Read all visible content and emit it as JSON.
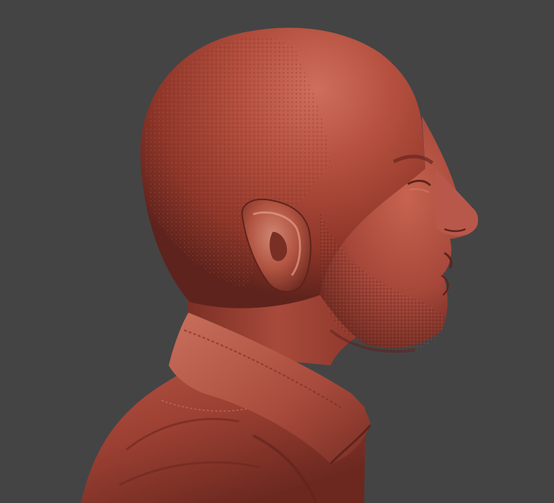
{
  "viewport": {
    "background_color": "#444445",
    "model_color": "#a8463a",
    "model_highlight_color": "#c96a58",
    "model_shadow_color": "#5e231c",
    "subject": "sculpted-head-bust-profile-right"
  }
}
